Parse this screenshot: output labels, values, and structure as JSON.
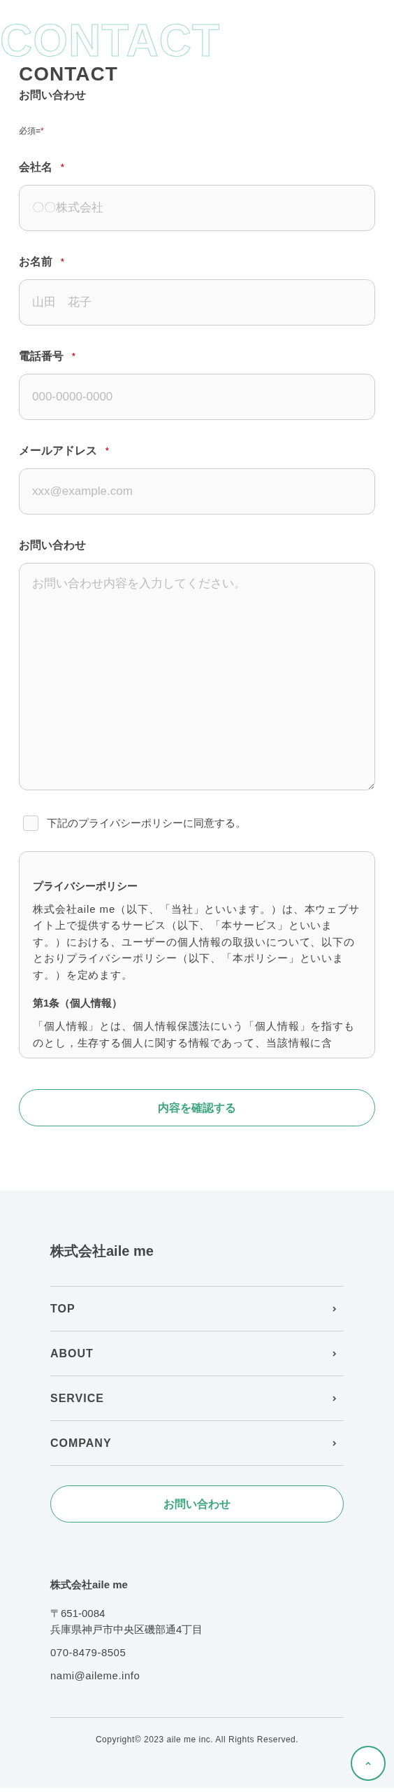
{
  "header": {
    "watermark": "CONTACT",
    "title": "CONTACT",
    "subtitle": "お問い合わせ"
  },
  "required_note": {
    "text": "必須=",
    "mark": "*"
  },
  "fields": [
    {
      "kind": "input",
      "label": "会社名",
      "mark": "*",
      "placeholder": "〇〇株式会社"
    },
    {
      "kind": "input",
      "label": "お名前",
      "mark": "*",
      "placeholder": "山田　花子"
    },
    {
      "kind": "input",
      "label": "電話番号",
      "mark": "*",
      "placeholder": "000-0000-0000"
    },
    {
      "kind": "input",
      "label": "メールアドレス",
      "mark": "*",
      "placeholder": "xxx@example.com"
    },
    {
      "kind": "textarea",
      "label": "お問い合わせ",
      "placeholder": "お問い合わせ内容を入力してください。"
    }
  ],
  "agree": {
    "label": "下記のプライバシーポリシーに同意する。",
    "checked": false
  },
  "privacy": {
    "title": "プライバシーポリシー",
    "blocks": [
      {
        "kind": "text",
        "text": "株式会社aile me（以下、「当社」といいます。）は、本ウェブサイト上で提供するサービス（以下、「本サービス」といいます。）における、ユーザーの個人情報の取扱いについて、以下のとおりプライバシーポリシー（以下、「本ポリシー」といいます。）を定めます。"
      },
      {
        "kind": "heading",
        "text": "第1条（個人情報）"
      },
      {
        "kind": "text",
        "text": "「個人情報」とは、個人情報保護法にいう「個人情報」を指すものとし，生存する個人に関する情報であって、当該情報に含"
      }
    ]
  },
  "submit": "内容を確認する",
  "footer": {
    "company": "株式会社aile me",
    "nav": [
      "TOP",
      "ABOUT",
      "SERVICE",
      "COMPANY"
    ],
    "contact_button": "お問い合わせ",
    "info": {
      "name": "株式会社aile me",
      "postal": "〒651-0084",
      "address": "兵庫県神戸市中央区磯部通4丁目",
      "phone": "070-8479-8505",
      "email": "nami@aileme.info"
    },
    "copyright": "Copyright© 2023 aile me inc. All Rights Reserved."
  }
}
